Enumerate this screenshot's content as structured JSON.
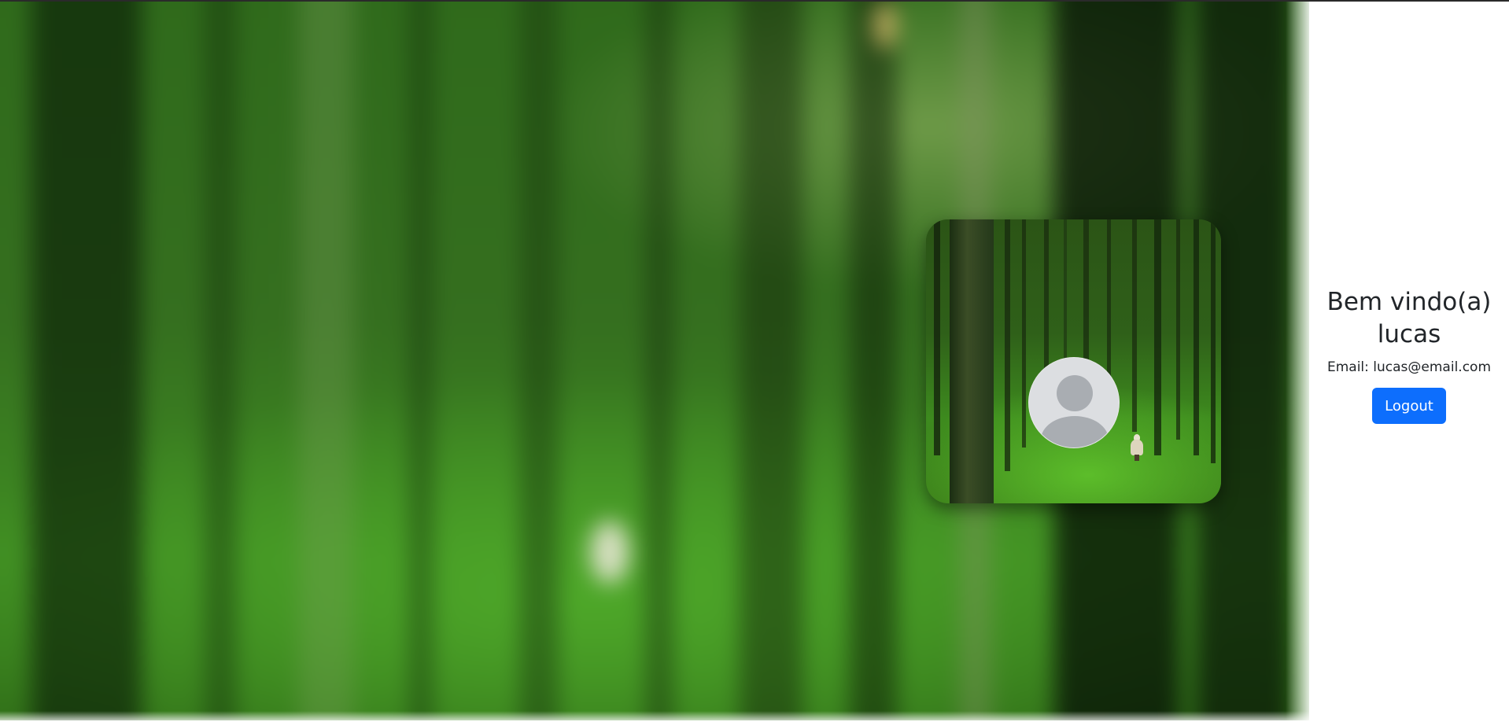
{
  "profile": {
    "greeting_line1": "Bem vindo(a)",
    "username": "lucas",
    "email_label": "Email:",
    "email_value": "lucas@email.com",
    "logout_label": "Logout"
  },
  "icons": {
    "avatar": "default-user-avatar-icon"
  },
  "colors": {
    "accent": "#0d6efd",
    "text": "#212529",
    "page_bg": "#ffffff",
    "forest_green": "#3f8c22",
    "avatar_bg": "#dcdee1",
    "avatar_fg": "#a9adb2"
  }
}
